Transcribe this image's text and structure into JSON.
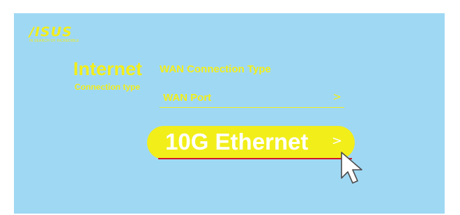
{
  "brand": {
    "logo_text": "/ISUS",
    "tagline": "IN SEARCH OF INCREDIBLE"
  },
  "section": {
    "title": "Internet",
    "subtitle": "Connection type"
  },
  "wan": {
    "type_label": "WAN Connection Type",
    "port_label": "WAN Port",
    "port_chevron": ">"
  },
  "option": {
    "label": "10G Ethernet",
    "chevron": ">"
  },
  "icons": [
    "mouse-cursor-icon",
    "chevron-right-icon"
  ],
  "colors": {
    "background": "#9fd8f3",
    "accent": "#f2ee1a",
    "underline": "#d3162a",
    "text_on_accent": "#ffffff"
  }
}
